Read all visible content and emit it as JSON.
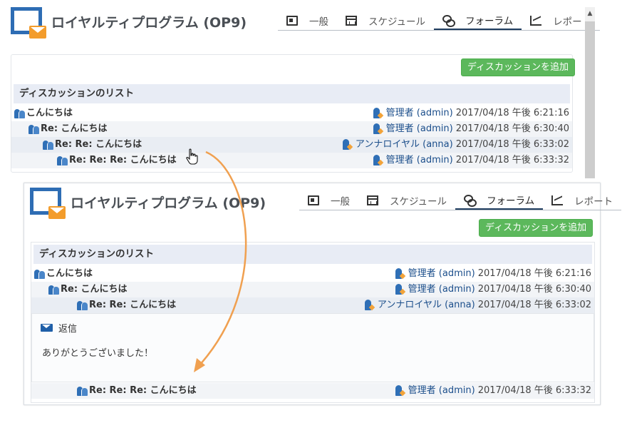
{
  "app": {
    "title": "ロイヤルティプログラム (OP9)"
  },
  "tabs": [
    {
      "label": "一般",
      "icon": "newspaper-icon"
    },
    {
      "label": "スケジュール",
      "icon": "calendar-icon"
    },
    {
      "label": "フォーラム",
      "icon": "forum-icon",
      "active": true
    },
    {
      "label": "レポート",
      "icon": "chart-icon"
    }
  ],
  "add_button_label": "ディスカッションを追加",
  "list_title": "ディスカッションのリスト",
  "threads": [
    {
      "subject": "こんにちは",
      "author": "管理者 (admin)",
      "date": "2017/04/18 午後 6:21:16"
    },
    {
      "subject": "Re: こんにちは",
      "author": "管理者 (admin)",
      "date": "2017/04/18 午後 6:30:40"
    },
    {
      "subject": "Re: Re: こんにちは",
      "author": "アンナロイヤル (anna)",
      "date": "2017/04/18 午後 6:33:02"
    },
    {
      "subject": "Re: Re: Re: こんにちは",
      "author": "管理者 (admin)",
      "date": "2017/04/18 午後 6:33:32"
    }
  ],
  "reply": {
    "label": "返信",
    "message": "ありがとうございました！"
  },
  "colors": {
    "accent_green": "#5cb85c",
    "brand_blue": "#2e6db4",
    "arrow_orange": "#f0a050",
    "header_bg": "#e8ecf5"
  }
}
